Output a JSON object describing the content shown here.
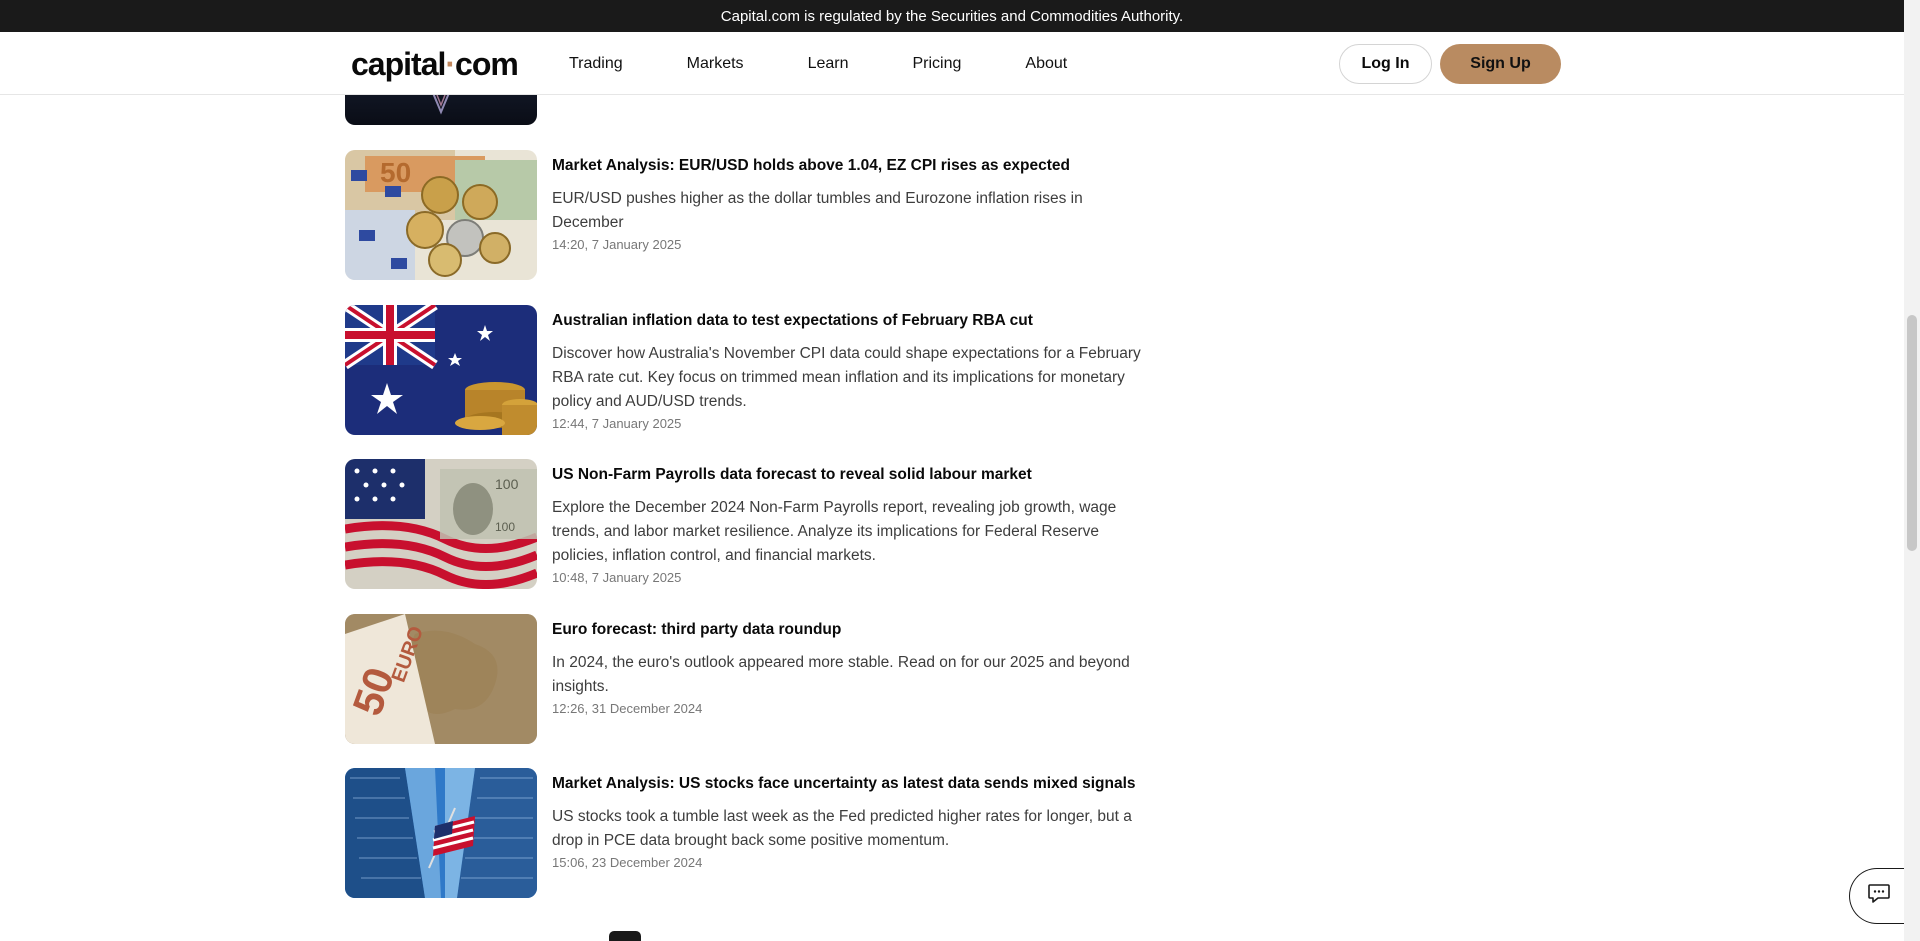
{
  "topbar": {
    "notice": "Capital.com is regulated by the Securities and Commodities Authority."
  },
  "header": {
    "logo_text_pre": "capital",
    "logo_dot": "·",
    "logo_text_post": "com",
    "nav": [
      "Trading",
      "Markets",
      "Learn",
      "Pricing",
      "About"
    ],
    "login_label": "Log In",
    "signup_label": "Sign Up"
  },
  "articles": [
    {
      "title": "Market Analysis: EUR/USD holds above 1.04, EZ CPI rises as expected",
      "description": "EUR/USD pushes higher as the dollar tumbles and Eurozone inflation rises in December",
      "date": "14:20, 7 January 2025"
    },
    {
      "title": "Australian inflation data to test expectations of February RBA cut",
      "description": "Discover how Australia's November CPI data could shape expectations for a February RBA rate cut. Key focus on trimmed mean inflation and its implications for monetary policy and AUD/USD trends.",
      "date": "12:44, 7 January 2025"
    },
    {
      "title": "US Non-Farm Payrolls data forecast to reveal solid labour market",
      "description": "Explore the December 2024 Non-Farm Payrolls report, revealing job growth, wage trends, and labor market resilience. Analyze its implications for Federal Reserve policies, inflation control, and financial markets.",
      "date": "10:48, 7 January 2025"
    },
    {
      "title": "Euro forecast: third party data roundup",
      "description": "In 2024, the euro's outlook appeared more stable. Read on for our 2025 and beyond insights.",
      "date": "12:26, 31 December 2024"
    },
    {
      "title": "Market Analysis: US stocks face uncertainty as latest data sends mixed signals",
      "description": "US stocks took a tumble last week as the Fed predicted higher rates for longer, but a drop in PCE data brought back some positive momentum.",
      "date": "15:06, 23 December 2024"
    }
  ],
  "colors": {
    "brand": "#b98b61",
    "topbar_bg": "#1a1a1a"
  },
  "icons": {
    "chat": "chat-bubble-icon"
  }
}
